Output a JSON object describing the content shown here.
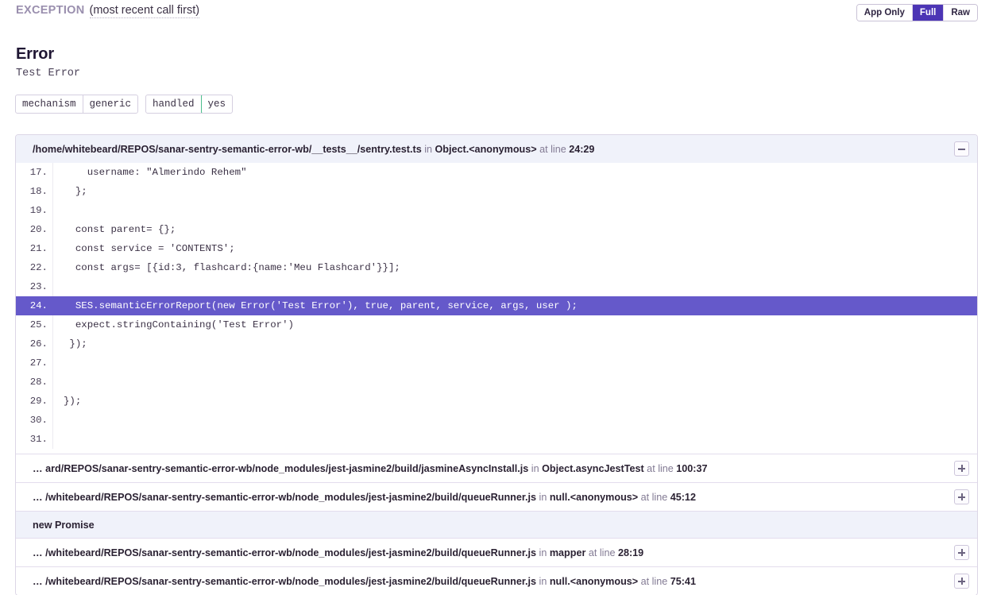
{
  "header": {
    "section_label": "EXCEPTION",
    "section_note": "(most recent call first)",
    "view_modes": [
      {
        "label": "App Only",
        "active": false
      },
      {
        "label": "Full",
        "active": true
      },
      {
        "label": "Raw",
        "active": false
      }
    ]
  },
  "error": {
    "type": "Error",
    "message": "Test Error",
    "meta": [
      {
        "key": "mechanism",
        "value": "generic",
        "status": "neutral"
      },
      {
        "key": "handled",
        "value": "yes",
        "status": "ok"
      }
    ]
  },
  "colors": {
    "accent": "#4c35b5",
    "highlight_line": "#6559ca",
    "frame_header_bg": "#f0f2fa",
    "ok_border": "#4cbd8d",
    "muted_text": "#837b94"
  },
  "trace": {
    "in_word": "in",
    "at_line_word": "at line",
    "frames": [
      {
        "id": "frame-sentry-test",
        "path": "/home/whitebeard/REPOS/sanar-sentry-semantic-error-wb/__tests__/sentry.test.ts",
        "function": "Object.<anonymous>",
        "line": "24:29",
        "expanded": true,
        "toggle_icon": "minus-icon",
        "context": [
          {
            "num": "17.",
            "code": "    username: \"Almerindo Rehem\"",
            "highlight": false
          },
          {
            "num": "18.",
            "code": "  };",
            "highlight": false
          },
          {
            "num": "19.",
            "code": "",
            "highlight": false
          },
          {
            "num": "20.",
            "code": "  const parent= {};",
            "highlight": false
          },
          {
            "num": "21.",
            "code": "  const service = 'CONTENTS';",
            "highlight": false
          },
          {
            "num": "22.",
            "code": "  const args= [{id:3, flashcard:{name:'Meu Flashcard'}}];",
            "highlight": false
          },
          {
            "num": "23.",
            "code": "",
            "highlight": false
          },
          {
            "num": "24.",
            "code": "  SES.semanticErrorReport(new Error('Test Error'), true, parent, service, args, user );",
            "highlight": true
          },
          {
            "num": "25.",
            "code": "  expect.stringContaining('Test Error')",
            "highlight": false
          },
          {
            "num": "26.",
            "code": " });",
            "highlight": false
          },
          {
            "num": "27.",
            "code": "",
            "highlight": false
          },
          {
            "num": "28.",
            "code": "",
            "highlight": false
          },
          {
            "num": "29.",
            "code": "});",
            "highlight": false
          },
          {
            "num": "30.",
            "code": "",
            "highlight": false
          },
          {
            "num": "31.",
            "code": "",
            "highlight": false
          }
        ]
      },
      {
        "id": "frame-jasmine-async-install",
        "path": "… ard/REPOS/sanar-sentry-semantic-error-wb/node_modules/jest-jasmine2/build/jasmineAsyncInstall.js",
        "function": "Object.asyncJestTest",
        "line": "100:37",
        "expanded": false,
        "toggle_icon": "plus-icon"
      },
      {
        "id": "frame-queue-runner-45",
        "path": "… /whitebeard/REPOS/sanar-sentry-semantic-error-wb/node_modules/jest-jasmine2/build/queueRunner.js",
        "function": "null.<anonymous>",
        "line": "45:12",
        "expanded": false,
        "toggle_icon": "plus-icon"
      },
      {
        "id": "frame-new-promise",
        "title_only": true,
        "path": "new Promise",
        "function": "",
        "line": "",
        "expanded": false,
        "toggle_icon": ""
      },
      {
        "id": "frame-queue-runner-28",
        "path": "… /whitebeard/REPOS/sanar-sentry-semantic-error-wb/node_modules/jest-jasmine2/build/queueRunner.js",
        "function": "mapper",
        "line": "28:19",
        "expanded": false,
        "toggle_icon": "plus-icon"
      },
      {
        "id": "frame-queue-runner-75",
        "path": "… /whitebeard/REPOS/sanar-sentry-semantic-error-wb/node_modules/jest-jasmine2/build/queueRunner.js",
        "function": "null.<anonymous>",
        "line": "75:41",
        "expanded": false,
        "toggle_icon": "plus-icon"
      }
    ]
  }
}
